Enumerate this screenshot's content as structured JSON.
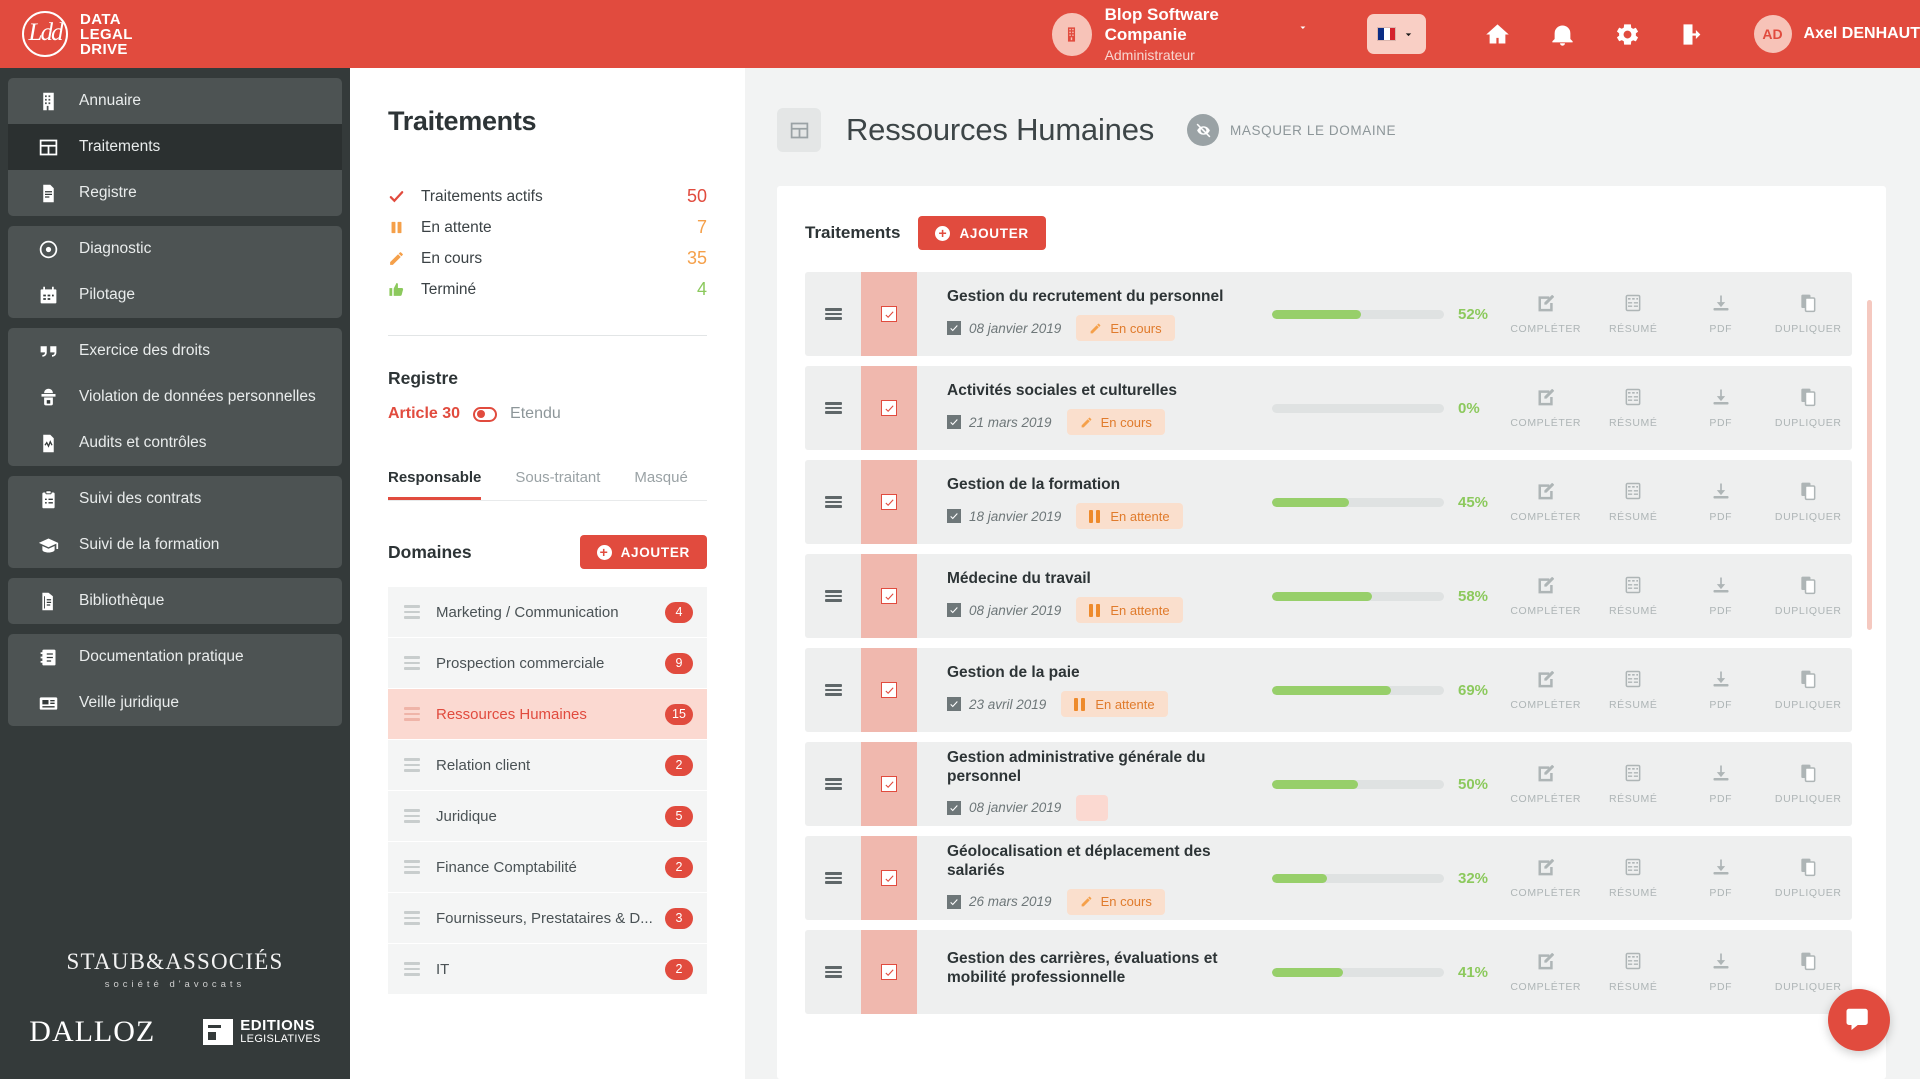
{
  "brand": {
    "line1": "DATA",
    "line2": "LEGAL",
    "line3": "DRIVE"
  },
  "topbar": {
    "org_name": "Blop Software Companie",
    "org_role": "Administrateur",
    "user_initials": "AD",
    "user_name": "Axel DENHAUT",
    "icons": [
      "home-icon",
      "bell-icon",
      "gear-icon",
      "exit-icon"
    ]
  },
  "sidebar": {
    "groups": [
      {
        "items": [
          {
            "label": "Annuaire",
            "icon": "building-icon",
            "active": false
          },
          {
            "label": "Traitements",
            "icon": "grid-icon",
            "active": true
          },
          {
            "label": "Registre",
            "icon": "document-icon",
            "active": false
          }
        ]
      },
      {
        "items": [
          {
            "label": "Diagnostic",
            "icon": "disc-icon",
            "active": false
          },
          {
            "label": "Pilotage",
            "icon": "calendar-icon",
            "active": false
          }
        ]
      },
      {
        "items": [
          {
            "label": "Exercice des droits",
            "icon": "quote-icon",
            "active": false
          },
          {
            "label": "Violation de données personnelles",
            "icon": "spy-icon",
            "active": false
          },
          {
            "label": "Audits et contrôles",
            "icon": "audit-icon",
            "active": false
          }
        ]
      },
      {
        "items": [
          {
            "label": "Suivi des contrats",
            "icon": "clipboard-icon",
            "active": false
          },
          {
            "label": "Suivi de la formation",
            "icon": "graduation-icon",
            "active": false
          }
        ]
      },
      {
        "items": [
          {
            "label": "Bibliothèque",
            "icon": "book-icon",
            "active": false
          }
        ]
      },
      {
        "items": [
          {
            "label": "Documentation pratique",
            "icon": "notebook-icon",
            "active": false
          },
          {
            "label": "Veille juridique",
            "icon": "news-icon",
            "active": false
          }
        ]
      }
    ],
    "sponsors": {
      "staub_name": "STAUB&ASSOCIÉS",
      "staub_sub": "société d'avocats",
      "dalloz": "DALLOZ",
      "editions_line1": "EDITIONS",
      "editions_line2": "LEGISLATIVES"
    }
  },
  "panel": {
    "title": "Traitements",
    "stats": [
      {
        "label": "Traitements actifs",
        "value": "50",
        "icon": "check-icon",
        "color": "#e14b3e"
      },
      {
        "label": "En attente",
        "value": "7",
        "icon": "pause-icon",
        "color": "#f5a04a"
      },
      {
        "label": "En cours",
        "value": "35",
        "icon": "pencil-icon",
        "color": "#f5a04a"
      },
      {
        "label": "Terminé",
        "value": "4",
        "icon": "thumbup-icon",
        "color": "#8cc95d"
      }
    ],
    "registre_title": "Registre",
    "registre_active": "Article 30",
    "registre_other": "Etendu",
    "tabs": [
      {
        "label": "Responsable",
        "active": true
      },
      {
        "label": "Sous-traitant",
        "active": false
      },
      {
        "label": "Masqué",
        "active": false
      }
    ],
    "domaines_title": "Domaines",
    "add_label": "AJOUTER",
    "domaines": [
      {
        "name": "Marketing / Communication",
        "count": "4",
        "selected": false
      },
      {
        "name": "Prospection commerciale",
        "count": "9",
        "selected": false
      },
      {
        "name": "Ressources Humaines",
        "count": "15",
        "selected": true
      },
      {
        "name": "Relation client",
        "count": "2",
        "selected": false
      },
      {
        "name": "Juridique",
        "count": "5",
        "selected": false
      },
      {
        "name": "Finance Comptabilité",
        "count": "2",
        "selected": false
      },
      {
        "name": "Fournisseurs, Prestataires & D...",
        "count": "3",
        "selected": false
      },
      {
        "name": "IT",
        "count": "2",
        "selected": false
      }
    ]
  },
  "main": {
    "title": "Ressources Humaines",
    "mask_label": "MASQUER LE DOMAINE",
    "card_title": "Traitements",
    "add_label": "AJOUTER",
    "actions": [
      {
        "label": "COMPLÉTER",
        "icon": "edit-icon"
      },
      {
        "label": "RÉSUMÉ",
        "icon": "summary-icon"
      },
      {
        "label": "PDF",
        "icon": "download-icon"
      },
      {
        "label": "DUPLIQUER",
        "icon": "copy-icon"
      }
    ],
    "rows": [
      {
        "name": "Gestion du recrutement du personnel",
        "date": "08 janvier 2019",
        "status": "En cours",
        "status_icon": "pencil-icon",
        "progress": 52,
        "progress_label": "52%"
      },
      {
        "name": "Activités sociales et culturelles",
        "date": "21 mars 2019",
        "status": "En cours",
        "status_icon": "pencil-icon",
        "progress": 0,
        "progress_label": "0%"
      },
      {
        "name": "Gestion de la formation",
        "date": "18 janvier 2019",
        "status": "En attente",
        "status_icon": "pause-icon",
        "progress": 45,
        "progress_label": "45%"
      },
      {
        "name": "Médecine du travail",
        "date": "08 janvier 2019",
        "status": "En attente",
        "status_icon": "pause-icon",
        "progress": 58,
        "progress_label": "58%"
      },
      {
        "name": "Gestion de la paie",
        "date": "23 avril 2019",
        "status": "En attente",
        "status_icon": "pause-icon",
        "progress": 69,
        "progress_label": "69%"
      },
      {
        "name": "Gestion administrative générale du personnel",
        "date": "08 janvier 2019",
        "status": "",
        "status_icon": "none",
        "progress": 50,
        "progress_label": "50%"
      },
      {
        "name": "Géolocalisation et déplacement des salariés",
        "date": "26 mars 2019",
        "status": "En cours",
        "status_icon": "pencil-icon",
        "progress": 32,
        "progress_label": "32%"
      },
      {
        "name": "Gestion des carrières, évaluations et mobilité professionnelle",
        "date": "",
        "status": "",
        "status_icon": "none",
        "progress": 41,
        "progress_label": "41%"
      }
    ]
  },
  "chat": {
    "icon": "chat-icon"
  },
  "colors": {
    "brand_red": "#e14b3e",
    "green": "#8cc95d",
    "orange": "#f5a04a",
    "sidebar": "#343a3a"
  }
}
